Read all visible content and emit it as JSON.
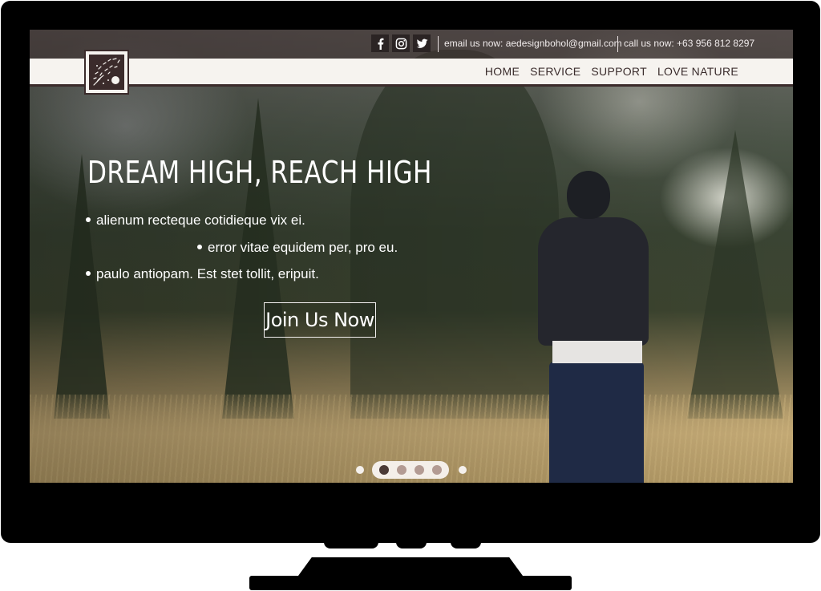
{
  "topbar": {
    "social": [
      {
        "icon": "facebook-icon",
        "glyph": "f"
      },
      {
        "icon": "instagram-icon",
        "glyph": ""
      },
      {
        "icon": "twitter-icon",
        "glyph": ""
      }
    ],
    "email_text": "email us now: aedesignbohol@gmail.com",
    "phone_text": "call us now: +63 956 812 8297"
  },
  "nav": {
    "items": [
      "HOME",
      "SERVICE",
      "SUPPORT",
      "LOVE NATURE"
    ]
  },
  "hero": {
    "title": "DREAM HIGH, REACH HIGH",
    "bullets": [
      "alienum recteque cotidieque vix ei.",
      "error vitae equidem per, pro eu.",
      "paulo antiopam. Est stet tollit, eripuit."
    ],
    "cta_label": "Join Us Now"
  },
  "slider": {
    "slide_count": 4,
    "active_index": 0
  },
  "colors": {
    "brand_dark": "#3b2b2b",
    "nav_bg": "#f6f3ef",
    "dot_inactive": "#b39b93",
    "dot_active": "#4a3a36"
  }
}
